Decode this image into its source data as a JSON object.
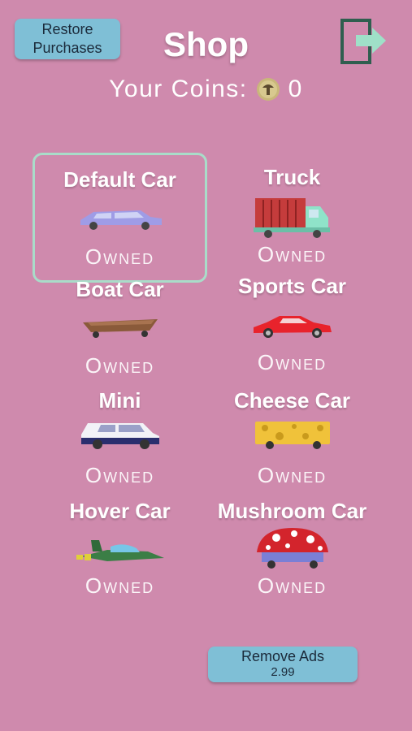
{
  "header": {
    "restore_label_line1": "Restore",
    "restore_label_line2": "Purchases",
    "title": "Shop",
    "exit_icon": "exit-door-icon"
  },
  "coins": {
    "label": "Your Coins:",
    "icon": "coin-icon",
    "value": "0"
  },
  "cars": [
    {
      "name": "Default Car",
      "status": "Owned",
      "selected": true
    },
    {
      "name": "Truck",
      "status": "Owned",
      "selected": false
    },
    {
      "name": "Boat Car",
      "status": "Owned",
      "selected": false
    },
    {
      "name": "Sports Car",
      "status": "Owned",
      "selected": false
    },
    {
      "name": "Mini",
      "status": "Owned",
      "selected": false
    },
    {
      "name": "Cheese Car",
      "status": "Owned",
      "selected": false
    },
    {
      "name": "Hover Car",
      "status": "Owned",
      "selected": false
    },
    {
      "name": "Mushroom Car",
      "status": "Owned",
      "selected": false
    }
  ],
  "footer": {
    "remove_ads_label": "Remove Ads",
    "remove_ads_price": "2.99"
  },
  "colors": {
    "background": "#cf8aad",
    "button": "#7fbfd6",
    "selection_border": "#a9dcc9",
    "exit_icon": "#2f5e4f",
    "exit_arrow": "#9fe0c8"
  }
}
